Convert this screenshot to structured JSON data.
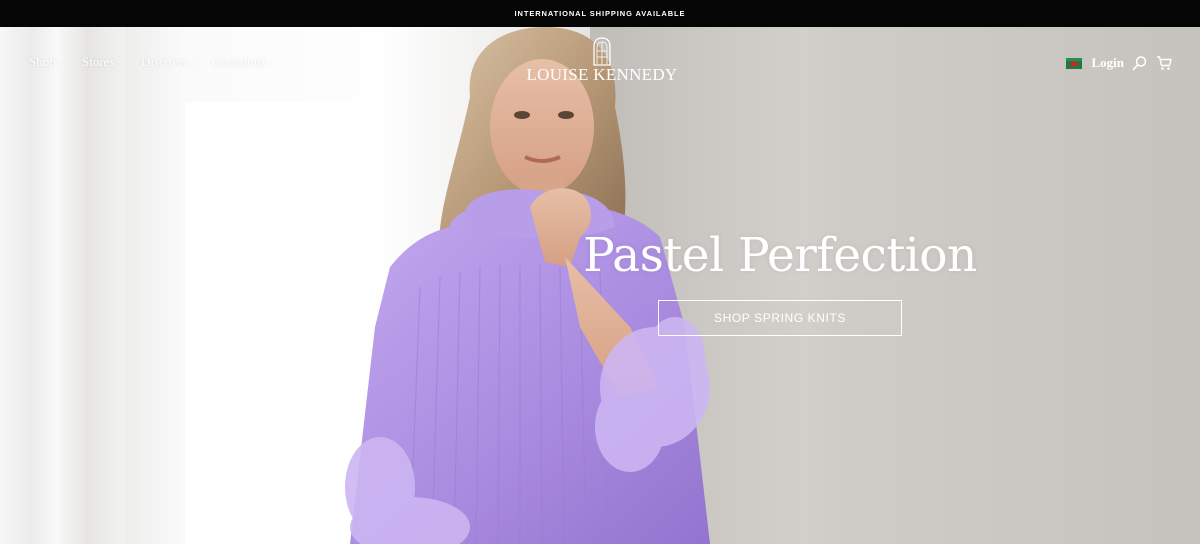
{
  "announcement": "INTERNATIONAL SHIPPING AVAILABLE",
  "nav": {
    "items": [
      {
        "label": "Shop"
      },
      {
        "label": "Stores"
      },
      {
        "label": "Discover"
      },
      {
        "label": "Occasions"
      }
    ]
  },
  "brand": {
    "name": "LOUISE KENNEDY"
  },
  "header": {
    "login_label": "Login",
    "icons": [
      "flag-icon",
      "search-icon",
      "cart-icon"
    ]
  },
  "hero": {
    "headline": "Pastel Perfection",
    "cta_label": "SHOP SPRING KNITS"
  },
  "colors": {
    "announcement_bg": "#050505",
    "text_on_hero": "#ffffff",
    "sweater": "#b295e6"
  }
}
